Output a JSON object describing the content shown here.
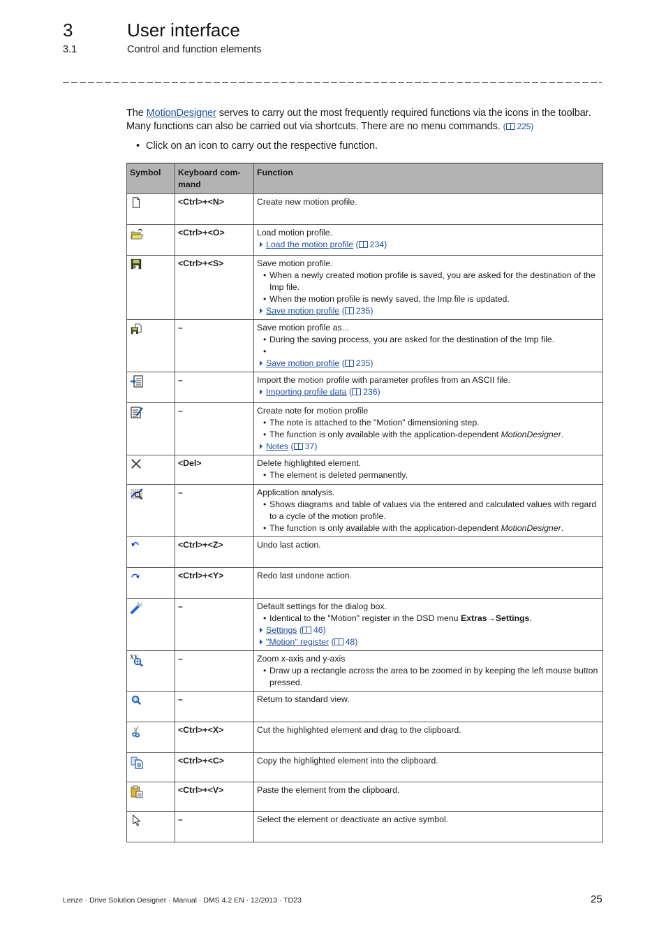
{
  "header": {
    "chapter_number": "3",
    "chapter_title": "User interface",
    "section_number": "3.1",
    "section_title": "Control and function elements"
  },
  "intro": {
    "text_before_link": "The ",
    "link_text": "MotionDesigner",
    "text_after_link": " serves to carry out the most frequently required functions via the icons in the toolbar. Many functions can also be carried out via shortcuts. There are no menu commands. ",
    "ref_page": "225",
    "bullet": "Click on an icon to carry out the respective function."
  },
  "table": {
    "headers": [
      "Symbol",
      "Keyboard com-mand",
      "Function"
    ],
    "rows": [
      {
        "icon": "new-document-icon",
        "key": "<Ctrl>+<N>",
        "title": "Create new motion profile.",
        "bullets": [],
        "links": []
      },
      {
        "icon": "open-folder-icon",
        "key": "<Ctrl>+<O>",
        "title": "Load motion profile.",
        "bullets": [],
        "links": [
          {
            "text": "Load the motion profile",
            "page": "234"
          }
        ]
      },
      {
        "icon": "save-disk-icon",
        "key": "<Ctrl>+<S>",
        "title": "Save motion profile.",
        "bullets": [
          "When a newly created motion profile is saved, you are asked for the destination of the Imp file.",
          "When the motion profile is newly saved, the Imp file is updated."
        ],
        "links": [
          {
            "text": "Save motion profile",
            "page": "235"
          }
        ]
      },
      {
        "icon": "save-as-icon",
        "key": "–",
        "title": "Save motion profile as...",
        "bullets": [
          "During the saving process, you are asked for the destination of the Imp file.",
          ""
        ],
        "links": [
          {
            "text": "Save motion profile",
            "page": "235"
          }
        ]
      },
      {
        "icon": "import-icon",
        "key": "–",
        "title": "Import the motion profile with parameter profiles from an ASCII file.",
        "bullets": [],
        "links": [
          {
            "text": "Importing profile data",
            "page": "236"
          }
        ]
      },
      {
        "icon": "note-icon",
        "key": "–",
        "title": "Create note for motion profile",
        "bullets": [
          "The note is attached to the \"Motion\" dimensioning step.",
          "The function is only available with the application-dependent |MotionDesigner|."
        ],
        "links": [
          {
            "text": "Notes",
            "page": "37"
          }
        ]
      },
      {
        "icon": "delete-icon",
        "key": "<Del>",
        "title": "Delete highlighted element.",
        "bullets": [
          "The element is deleted permanently."
        ],
        "links": []
      },
      {
        "icon": "analysis-icon",
        "key": "–",
        "title": "Application analysis.",
        "bullets": [
          "Shows diagrams and table of values via the entered and calculated values with regard to a cycle of the motion profile.",
          "The function is only available with the application-dependent |MotionDesigner|."
        ],
        "links": []
      },
      {
        "icon": "undo-icon",
        "key": "<Ctrl>+<Z>",
        "title": "Undo last action.",
        "bullets": [],
        "links": []
      },
      {
        "icon": "redo-icon",
        "key": "<Ctrl>+<Y>",
        "title": "Redo last undone action.",
        "bullets": [],
        "links": []
      },
      {
        "icon": "settings-wrench-icon",
        "key": "–",
        "title": "Default settings for the dialog box.",
        "bullets": [
          "Identical to the \"Motion\" register in the DSD menu ##Extras→Settings##."
        ],
        "links": [
          {
            "text": "Settings",
            "page": "46"
          },
          {
            "text": "\"Motion\" register",
            "page": "48"
          }
        ]
      },
      {
        "icon": "zoom-xy-icon",
        "key": "–",
        "title": "Zoom x-axis and y-axis",
        "bullets": [
          "Draw up a rectangle across the area to be zoomed in by keeping the left mouse button pressed."
        ],
        "links": []
      },
      {
        "icon": "zoom-reset-icon",
        "key": "–",
        "title": "Return to standard view.",
        "bullets": [],
        "links": []
      },
      {
        "icon": "cut-icon",
        "key": "<Ctrl>+<X>",
        "title": "Cut the highlighted element and drag to the clipboard.",
        "bullets": [],
        "links": []
      },
      {
        "icon": "copy-icon",
        "key": "<Ctrl>+<C>",
        "title": "Copy the highlighted element into the clipboard.",
        "bullets": [],
        "links": []
      },
      {
        "icon": "paste-icon",
        "key": "<Ctrl>+<V>",
        "title": "Paste the element from the clipboard.",
        "bullets": [],
        "links": []
      },
      {
        "icon": "select-pointer-icon",
        "key": "–",
        "title": "Select the element or deactivate an active symbol.",
        "bullets": [],
        "links": []
      }
    ]
  },
  "footer": {
    "text": "Lenze · Drive Solution Designer · Manual · DMS 4.2 EN · 12/2013 · TD23",
    "page_number": "25"
  }
}
